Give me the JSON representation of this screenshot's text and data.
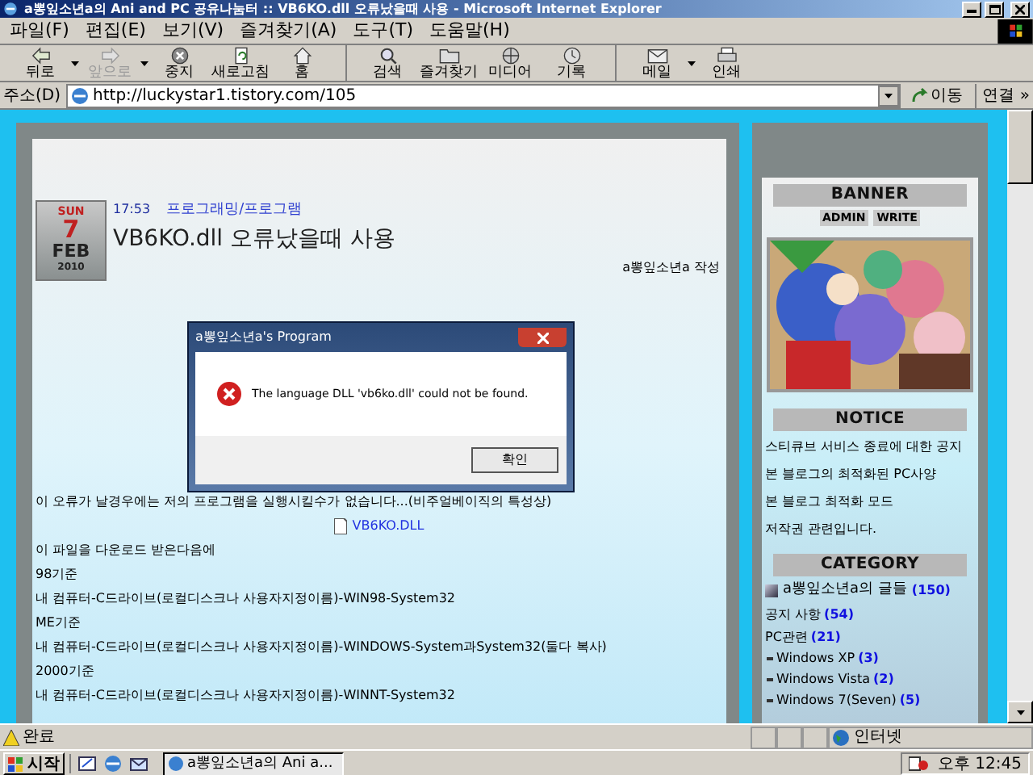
{
  "window": {
    "title": "a뽕잎소년a의 Ani and PC 공유나눔터 :: VB6KO.dll 오류났을때 사용 - Microsoft Internet Explorer"
  },
  "menu": [
    "파일(F)",
    "편집(E)",
    "보기(V)",
    "즐겨찾기(A)",
    "도구(T)",
    "도움말(H)"
  ],
  "toolbar": [
    {
      "kind": "back",
      "label": "뒤로",
      "disabled": false,
      "dropdown": true
    },
    {
      "kind": "forward",
      "label": "앞으로",
      "disabled": true,
      "dropdown": true
    },
    {
      "kind": "stop",
      "label": "중지",
      "disabled": false,
      "dropdown": false
    },
    {
      "kind": "refresh",
      "label": "새로고침",
      "disabled": false,
      "dropdown": false
    },
    {
      "kind": "home",
      "label": "홈",
      "disabled": false,
      "dropdown": false
    },
    {
      "kind": "search",
      "label": "검색",
      "disabled": false,
      "dropdown": false
    },
    {
      "kind": "favorites",
      "label": "즐겨찾기",
      "disabled": false,
      "dropdown": false
    },
    {
      "kind": "media",
      "label": "미디어",
      "disabled": false,
      "dropdown": false
    },
    {
      "kind": "history",
      "label": "기록",
      "disabled": false,
      "dropdown": false
    },
    {
      "kind": "mail",
      "label": "메일",
      "disabled": false,
      "dropdown": true
    },
    {
      "kind": "print",
      "label": "인쇄",
      "disabled": false,
      "dropdown": false
    }
  ],
  "address_bar": {
    "label": "주소(D)",
    "value": "http://luckystar1.tistory.com/105",
    "go": "이동",
    "links": "연결 »"
  },
  "post": {
    "date": {
      "weekday": "SUN",
      "day": "7",
      "month": "FEB",
      "year": "2010"
    },
    "time": "17:53",
    "category": "프로그래밍/프로그램",
    "title": "VB6KO.dll 오류났을때 사용",
    "author": "a뽕잎소년a 작성",
    "lines": [
      {
        "kind": "text",
        "text": "이 오류가 날경우에는 저의 프로그램을 실행시킬수가 없습니다...(비주얼베이직의 특성상)"
      },
      {
        "kind": "file",
        "text": "VB6KO.DLL"
      },
      {
        "kind": "text",
        "text": "이 파일을 다운로드 받은다음에"
      },
      {
        "kind": "text",
        "text": "98기준"
      },
      {
        "kind": "text",
        "text": "내 컴퓨터-C드라이브(로컬디스크나 사용자지정이름)-WIN98-System32"
      },
      {
        "kind": "text",
        "text": "ME기준"
      },
      {
        "kind": "text",
        "text": "내 컴퓨터-C드라이브(로컬디스크나 사용자지정이름)-WINDOWS-System과System32(둘다 복사)"
      },
      {
        "kind": "text",
        "text": "2000기준"
      },
      {
        "kind": "text",
        "text": "내 컴퓨터-C드라이브(로컬디스크나 사용자지정이름)-WINNT-System32"
      }
    ]
  },
  "dialog": {
    "title": "a뽕잎소년a's Program",
    "message": "The language DLL 'vb6ko.dll' could not be found.",
    "button": "확인"
  },
  "sidebar": {
    "banner": {
      "title": "BANNER",
      "buttons": [
        "ADMIN",
        "WRITE"
      ]
    },
    "notice": {
      "title": "NOTICE",
      "items": [
        "스티큐브 서비스 종료에 대한 공지",
        "본 블로그의 최적화된 PC사양",
        "본 블로그 최적화 모드",
        "저작권 관련입니다."
      ]
    },
    "category": {
      "title": "CATEGORY",
      "root": {
        "label": "a뽕잎소년a의 글들",
        "count": "(150)"
      },
      "items": [
        {
          "label": "공지 사항",
          "count": "(54)"
        },
        {
          "label": "PC관련",
          "count": "(21)",
          "children": [
            {
              "label": "Windows XP",
              "count": "(3)"
            },
            {
              "label": "Windows Vista",
              "count": "(2)"
            },
            {
              "label": "Windows 7(Seven)",
              "count": "(5)"
            }
          ]
        }
      ]
    }
  },
  "status_bar": {
    "text": "완료",
    "zone": "인터넷"
  },
  "taskbar": {
    "start": "시작",
    "tasks": [
      {
        "label": "a뽕잎소년a의 Ani a...",
        "selected": true
      }
    ],
    "clock": "오후 12:45"
  }
}
